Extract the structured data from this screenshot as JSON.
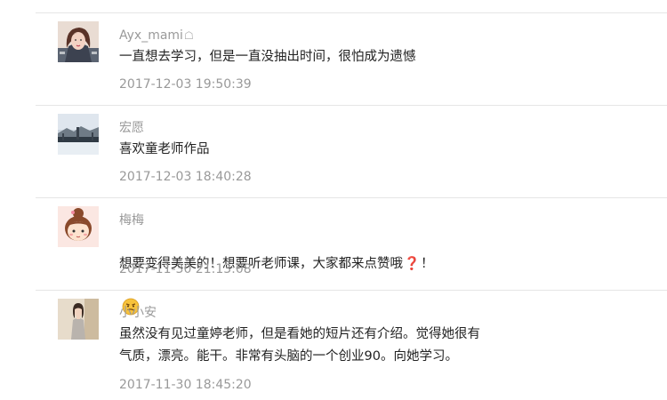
{
  "comments": [
    {
      "name": "Ayx_mami",
      "badge": "☖",
      "text": "一直想去学习，但是一直没抽出时间，很怕成为遗憾",
      "time": "2017-12-03 19:50:39",
      "avatar_icon": "woman-portrait-avatar"
    },
    {
      "name": "宏愿",
      "text": "喜欢童老师作品",
      "time": "2017-12-03 18:40:28",
      "avatar_icon": "winter-landscape-avatar"
    },
    {
      "name": "梅梅",
      "text_parts": [
        "想要变得美美的！想要听老师课，大家都来点赞哦",
        "❓",
        "！"
      ],
      "emoji": "smirk-emoji",
      "time": "2017-11-30 21:13:08",
      "avatar_icon": "cartoon-girl-avatar"
    },
    {
      "name": "小小安",
      "text": "虽然没有见过童婷老师，但是看她的短片还有介绍。觉得她很有\n气质，漂亮。能干。非常有头脑的一个创业90。向她学习。",
      "time": "2017-11-30 18:45:20",
      "avatar_icon": "woman-standing-avatar"
    }
  ]
}
